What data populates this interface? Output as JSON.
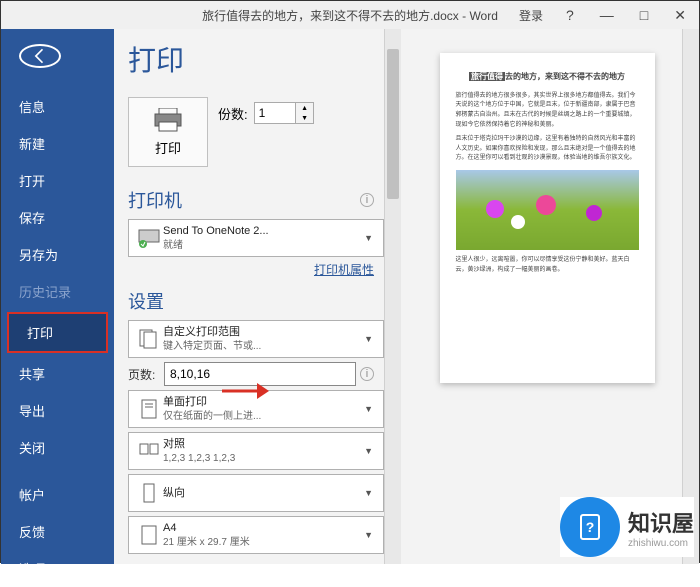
{
  "titlebar": {
    "filename": "旅行值得去的地方，来到这不得不去的地方.docx - Word",
    "login": "登录",
    "help": "?",
    "minimize": "—",
    "maximize": "□",
    "close": "✕"
  },
  "sidebar": {
    "items": [
      {
        "label": "信息",
        "key": "info"
      },
      {
        "label": "新建",
        "key": "new"
      },
      {
        "label": "打开",
        "key": "open"
      },
      {
        "label": "保存",
        "key": "save"
      },
      {
        "label": "另存为",
        "key": "saveas"
      },
      {
        "label": "历史记录",
        "key": "history",
        "disabled": true
      },
      {
        "label": "打印",
        "key": "print",
        "active": true,
        "highlight": true
      },
      {
        "label": "共享",
        "key": "share"
      },
      {
        "label": "导出",
        "key": "export"
      },
      {
        "label": "关闭",
        "key": "close"
      }
    ],
    "footer": [
      {
        "label": "帐户",
        "key": "account"
      },
      {
        "label": "反馈",
        "key": "feedback"
      },
      {
        "label": "选项",
        "key": "options"
      }
    ]
  },
  "print": {
    "title": "打印",
    "printButton": "打印",
    "copies": {
      "label": "份数:",
      "value": "1"
    },
    "printerHeader": "打印机",
    "printer": {
      "name": "Send To OneNote 2...",
      "status": "就绪"
    },
    "printerPropsLink": "打印机属性",
    "settingsHeader": "设置",
    "range": {
      "primary": "自定义打印范围",
      "secondary": "键入特定页面、节或..."
    },
    "pages": {
      "label": "页数:",
      "value": "8,10,16"
    },
    "side": {
      "primary": "单面打印",
      "secondary": "仅在纸面的一侧上进..."
    },
    "collate": {
      "primary": "对照",
      "secondary": "1,2,3    1,2,3    1,2,3"
    },
    "orientation": {
      "primary": "纵向",
      "secondary": ""
    },
    "paper": {
      "primary": "A4",
      "secondary": "21 厘米 x 29.7 厘米"
    }
  },
  "preview": {
    "title_hl": "旅行值得",
    "title_rest": "去的地方，来到这不得不去的地方",
    "para1": "旅行值得去的地方很多很多，其实世界上很多地方都值得去。我们今天说的这个地方位于中国，它就是且末，位于新疆南部，隶属于巴音郭楞蒙古自治州。且末在古代的时候是丝绸之路上的一个重要城镇，现如今它依然保持着它的神秘和美丽。",
    "para2": "且末位于塔克拉玛干沙漠的边缘，这里有着独特的自然风光和丰富的人文历史。如果你喜欢探险和发现，那么且末绝对是一个值得去的地方。在这里你可以看到壮观的沙漠景观，体验当地的维吾尔族文化。",
    "para3": "这里人很少，远离喧嚣，你可以尽情享受这份宁静和美好。蓝天白云，黄沙绿洲，构成了一幅美丽的画卷。"
  },
  "logo": {
    "cn": "知识屋",
    "url": "zhishiwu.com"
  }
}
